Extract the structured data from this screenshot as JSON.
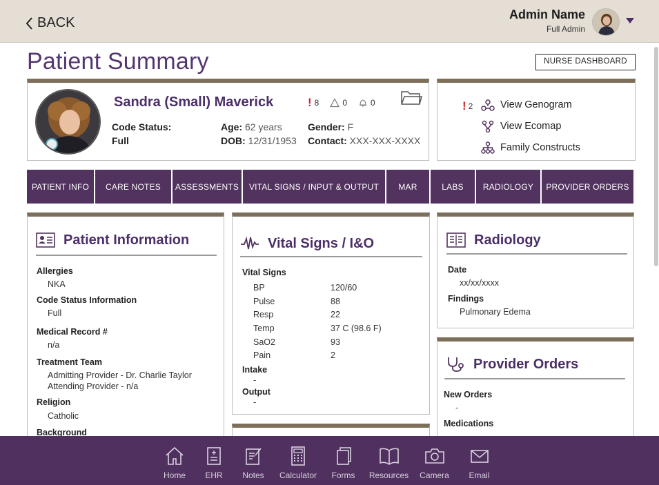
{
  "header": {
    "back_label": "BACK",
    "admin_name": "Admin Name",
    "admin_role": "Full Admin"
  },
  "page": {
    "title": "Patient Summary",
    "nurse_dashboard_label": "NURSE DASHBOARD"
  },
  "patient": {
    "name": "Sandra (Small) Maverick",
    "alerts": {
      "critical": "8",
      "warnings": "0",
      "notifications": "0"
    },
    "code_status_label": "Code Status:",
    "code_status_value": "Full",
    "age_label": "Age:",
    "age_value": "62 years",
    "dob_label": "DOB:",
    "dob_value": "12/31/1953",
    "gender_label": "Gender:",
    "gender_value": "F",
    "contact_label": "Contact:",
    "contact_value": "XXX-XXX-XXXX"
  },
  "family_links": {
    "alert_count": "2",
    "genogram": "View Genogram",
    "ecomap": "View Ecomap",
    "constructs": "Family Constructs"
  },
  "tabs": [
    "PATIENT INFO",
    "CARE NOTES",
    "ASSESSMENTS",
    "VITAL SIGNS / INPUT & OUTPUT",
    "MAR",
    "LABS",
    "RADIOLOGY",
    "PROVIDER ORDERS"
  ],
  "patient_information": {
    "title": "Patient Information",
    "allergies_label": "Allergies",
    "allergies_value": "NKA",
    "code_status_label": "Code Status Information",
    "code_status_value": "Full",
    "mrn_label": "Medical Record #",
    "mrn_value": "n/a",
    "team_label": "Treatment Team",
    "team_admitting": "Admitting Provider  -  Dr. Charlie Taylor",
    "team_attending": "Attending Provider - n/a",
    "religion_label": "Religion",
    "religion_value": "Catholic",
    "background_label": "Background"
  },
  "vital_signs": {
    "title": "Vital Signs / I&O",
    "section_label": "Vital Signs",
    "rows": [
      {
        "name": "BP",
        "value": "120/60"
      },
      {
        "name": "Pulse",
        "value": "88"
      },
      {
        "name": "Resp",
        "value": "22"
      },
      {
        "name": "Temp",
        "value": "37 C (98.6 F)"
      },
      {
        "name": "SaO2",
        "value": "93"
      },
      {
        "name": "Pain",
        "value": "2"
      }
    ],
    "intake_label": "Intake",
    "intake_value": "-",
    "output_label": "Output",
    "output_value": "-"
  },
  "radiology": {
    "title": "Radiology",
    "date_label": "Date",
    "date_value": "xx/xx/xxxx",
    "findings_label": "Findings",
    "findings_value": "Pulmonary Edema"
  },
  "provider_orders": {
    "title": "Provider Orders",
    "new_orders_label": "New Orders",
    "new_orders_value": "-",
    "medications_label": "Medications"
  },
  "bottom_nav": [
    {
      "label": "Home",
      "icon": "home-icon"
    },
    {
      "label": "EHR",
      "icon": "ehr-icon"
    },
    {
      "label": "Notes",
      "icon": "notes-icon"
    },
    {
      "label": "Calculator",
      "icon": "calculator-icon"
    },
    {
      "label": "Forms",
      "icon": "forms-icon"
    },
    {
      "label": "Resources",
      "icon": "resources-icon"
    },
    {
      "label": "Camera",
      "icon": "camera-icon"
    },
    {
      "label": "Email",
      "icon": "email-icon"
    }
  ],
  "colors": {
    "brand_purple": "#52325f",
    "title_purple": "#4b2f67",
    "card_accent": "#7d6f5a",
    "alert_red": "#d0272f"
  }
}
